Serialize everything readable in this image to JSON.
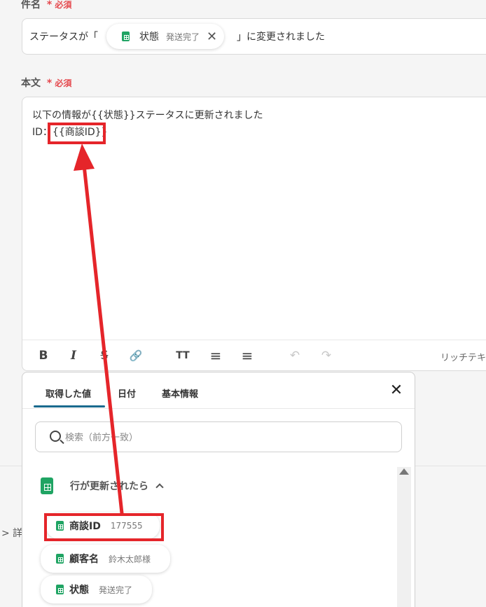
{
  "subject": {
    "label": "件名",
    "required": "必須",
    "text_before": "ステータスが「",
    "text_after": "」に変更されました",
    "chip": {
      "icon": "google-sheets-icon",
      "label": "状態",
      "value": "発送完了"
    }
  },
  "body": {
    "label": "本文",
    "required": "必須",
    "line1": "以下の情報が{{状態}}ステータスに更新されました",
    "line2_prefix": "ID：",
    "line2_var": "{{商談ID}}"
  },
  "toolbar": {
    "bold": "B",
    "italic": "I",
    "strike": "S",
    "link": "🔗",
    "font_size": "TT",
    "bullet_list": "≡",
    "number_list": "≡",
    "undo": "↶",
    "redo": "↷",
    "rich_text_label": "リッチテキ"
  },
  "behind_text": "> 詳",
  "popup": {
    "tabs": [
      "取得した値",
      "日付",
      "基本情報"
    ],
    "active_tab": "取得した値",
    "search_placeholder": "検索（前方一致）",
    "section_title": "行が更新されたら",
    "items": [
      {
        "label": "商談ID",
        "value": "177555"
      },
      {
        "label": "顧客名",
        "value": "鈴木太郎様"
      },
      {
        "label": "状態",
        "value": "発送完了"
      }
    ]
  },
  "colors": {
    "annotation": "#e5252a",
    "sheets_green": "#1fa463",
    "tab_underline": "#1a6a8e",
    "required": "#e5484d"
  }
}
